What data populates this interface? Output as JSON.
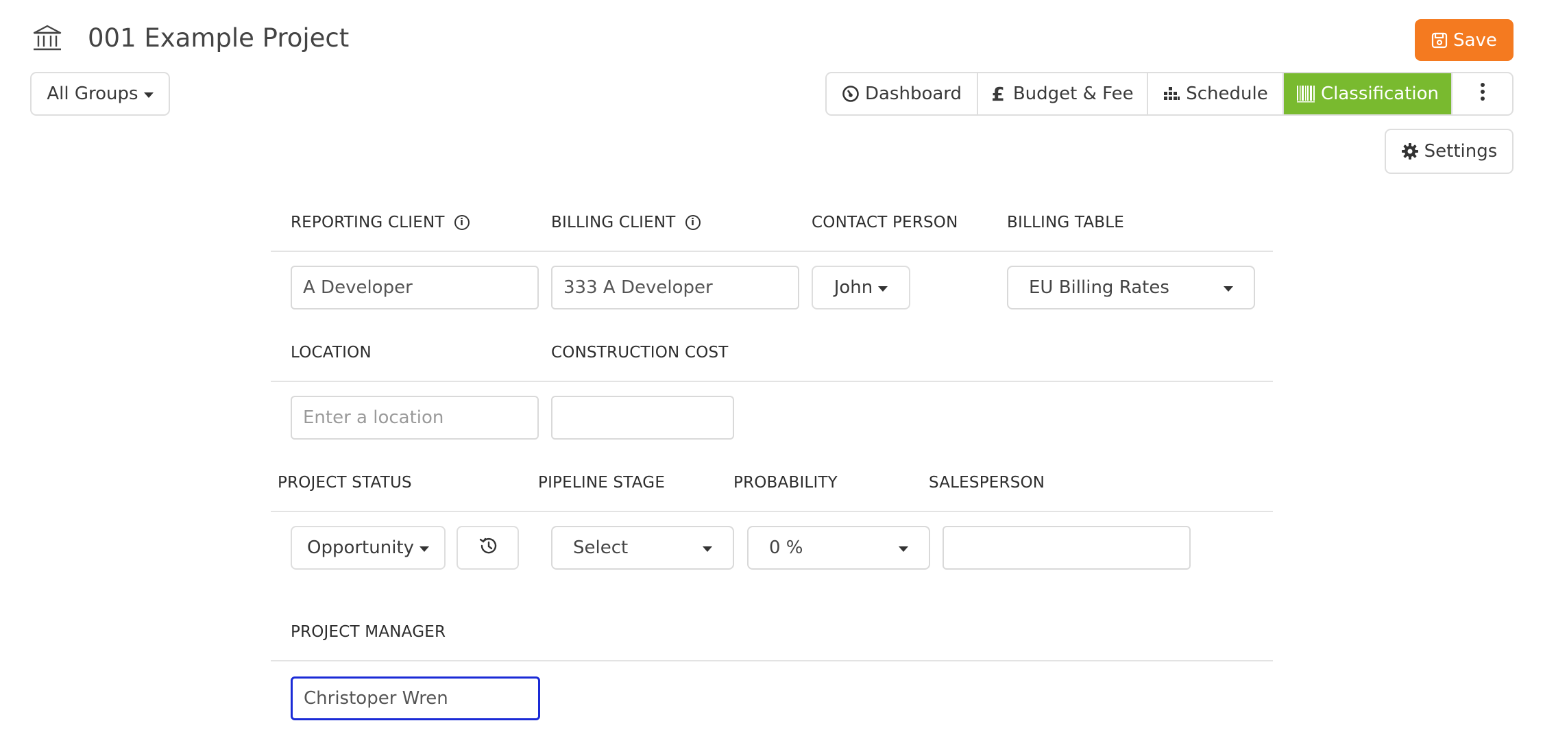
{
  "header": {
    "project_title": "001 Example Project",
    "project_icon": "building-columns-icon",
    "save_label": "Save",
    "save_icon": "floppy-disk-icon",
    "save_color": "#f47a20"
  },
  "toolbar": {
    "groups_label": "All Groups",
    "settings_label": "Settings",
    "settings_icon": "gear-icon"
  },
  "tabs": [
    {
      "label": "Dashboard",
      "icon": "gauge-icon",
      "active": false
    },
    {
      "label": "Budget & Fee",
      "icon": "pound-sign-icon",
      "active": false
    },
    {
      "label": "Schedule",
      "icon": "chart-bars-icon",
      "active": false
    },
    {
      "label": "Classification",
      "icon": "barcode-icon",
      "active": true
    }
  ],
  "tabs_more_icon": "vertical-ellipsis-icon",
  "tabs_active_color": "#79ba2f",
  "form": {
    "reporting_client": {
      "label": "REPORTING CLIENT",
      "value": "A Developer"
    },
    "billing_client": {
      "label": "BILLING CLIENT",
      "value": "333 A Developer"
    },
    "contact_person": {
      "label": "CONTACT PERSON",
      "value": "John"
    },
    "billing_table": {
      "label": "BILLING TABLE",
      "value": "EU Billing Rates"
    },
    "location": {
      "label": "LOCATION",
      "placeholder": "Enter a location",
      "value": ""
    },
    "construction_cost": {
      "label": "CONSTRUCTION COST",
      "value": ""
    },
    "project_status": {
      "label": "PROJECT STATUS",
      "value": "Opportunity",
      "history_icon": "history-icon"
    },
    "pipeline_stage": {
      "label": "PIPELINE STAGE",
      "value": "Select"
    },
    "probability": {
      "label": "PROBABILITY",
      "value": "0 %"
    },
    "salesperson": {
      "label": "SALESPERSON",
      "value": ""
    },
    "project_manager": {
      "label": "PROJECT MANAGER",
      "value": "Christoper Wren"
    }
  }
}
